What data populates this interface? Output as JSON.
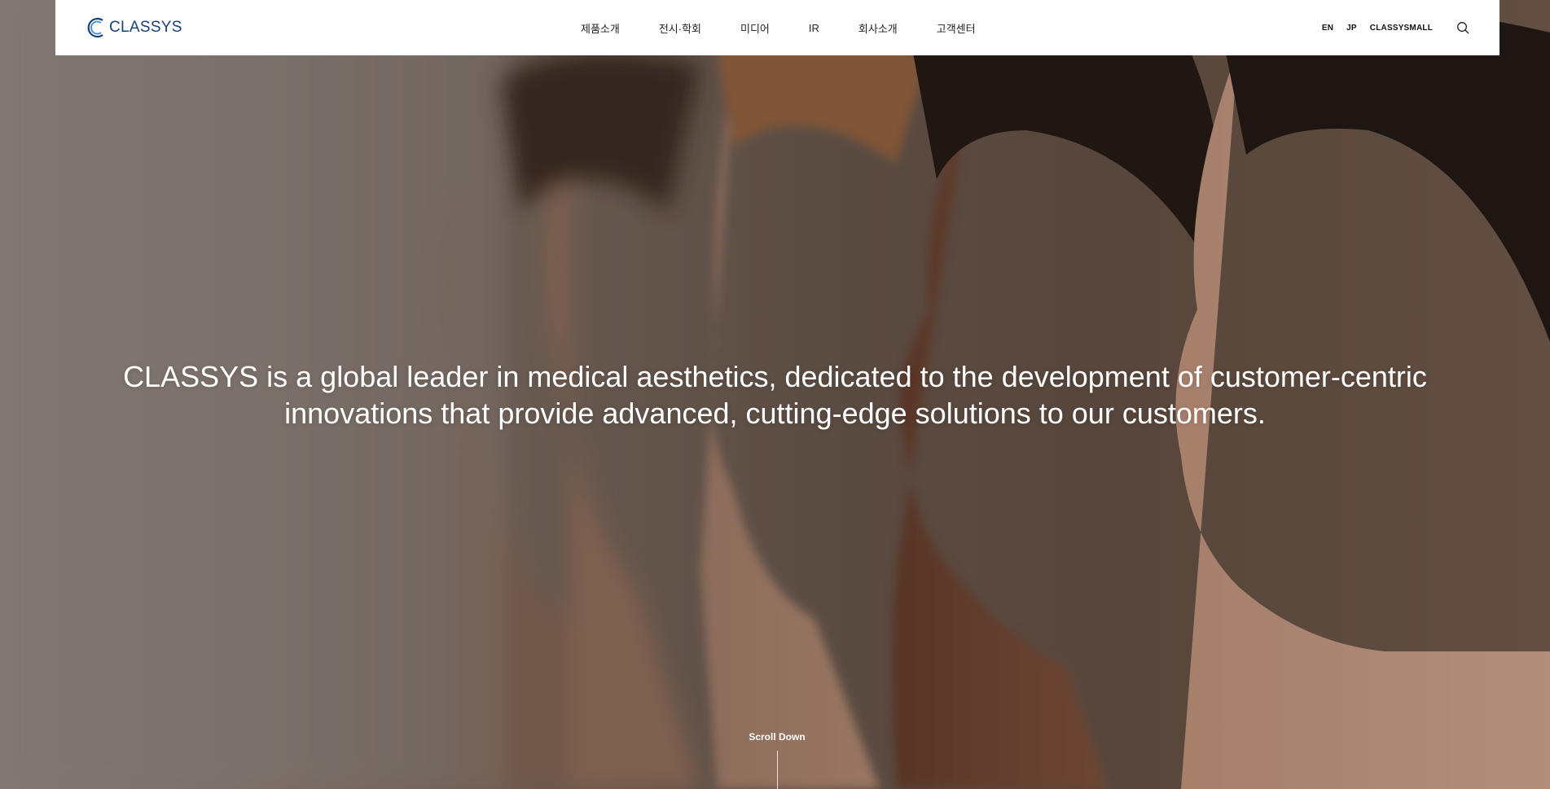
{
  "header": {
    "logo_text": "CLASSYS",
    "nav": [
      "제품소개",
      "전시·학회",
      "미디어",
      "IR",
      "회사소개",
      "고객센터"
    ],
    "utility": [
      "EN",
      "JP",
      "CLASSYSMALL"
    ],
    "search_icon": "search-icon"
  },
  "hero": {
    "headline_line1": "CLASSYS is a global leader in medical aesthetics, dedicated to the development of customer-centric",
    "headline_line2": "innovations that provide advanced, cutting-edge solutions to our customers.",
    "scroll_label": "Scroll Down"
  },
  "colors": {
    "brand": "#1c3f77",
    "header_bg": "#ffffff",
    "headline": "#ffffff"
  }
}
